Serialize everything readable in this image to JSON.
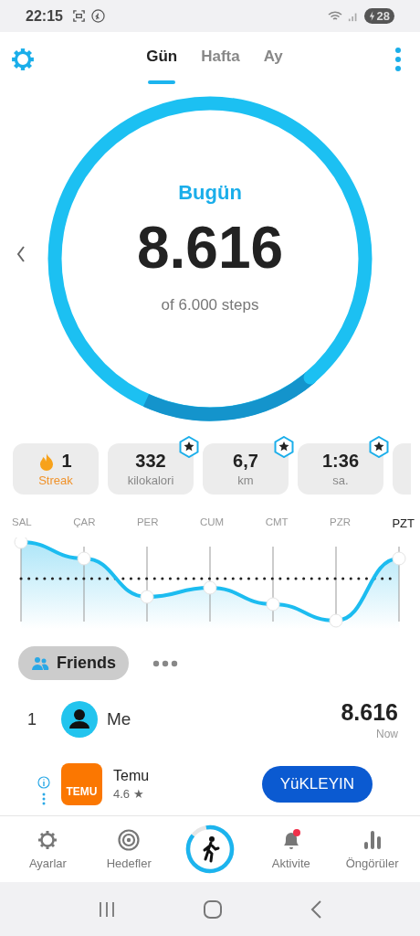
{
  "status_bar": {
    "time": "22:15",
    "battery": "28"
  },
  "tabs": [
    {
      "label": "Gün",
      "selected": true
    },
    {
      "label": "Hafta",
      "selected": false
    },
    {
      "label": "Ay",
      "selected": false
    }
  ],
  "today": {
    "title": "Bugün",
    "steps": "8.616",
    "goal": "of 6.000 steps"
  },
  "stats": [
    {
      "kind": "streak",
      "value": "1",
      "label": "Streak"
    },
    {
      "kind": "metric",
      "value": "332",
      "label": "kilokalori"
    },
    {
      "kind": "metric",
      "value": "6,7",
      "label": "km"
    },
    {
      "kind": "metric",
      "value": "1:36",
      "label": "sa."
    }
  ],
  "week": [
    {
      "label": "SAL",
      "selected": false
    },
    {
      "label": "ÇAR",
      "selected": false
    },
    {
      "label": "PER",
      "selected": false
    },
    {
      "label": "CUM",
      "selected": false
    },
    {
      "label": "CMT",
      "selected": false
    },
    {
      "label": "PZR",
      "selected": false
    },
    {
      "label": "PZT",
      "selected": true
    }
  ],
  "friends": {
    "label": "Friends",
    "rows": [
      {
        "rank": "1",
        "name": "Me",
        "steps": "8.616",
        "time": "Now"
      }
    ]
  },
  "ad": {
    "name": "Temu",
    "logo": "TEMU",
    "rating": "4.6 ★",
    "button": "YüKLEYIN"
  },
  "nav": [
    {
      "kind": "settings",
      "label": "Ayarlar"
    },
    {
      "kind": "goals",
      "label": "Hedefler"
    },
    {
      "kind": "walk"
    },
    {
      "kind": "activity",
      "label": "Aktivite"
    },
    {
      "kind": "insights",
      "label": "Öngörüler"
    }
  ]
}
